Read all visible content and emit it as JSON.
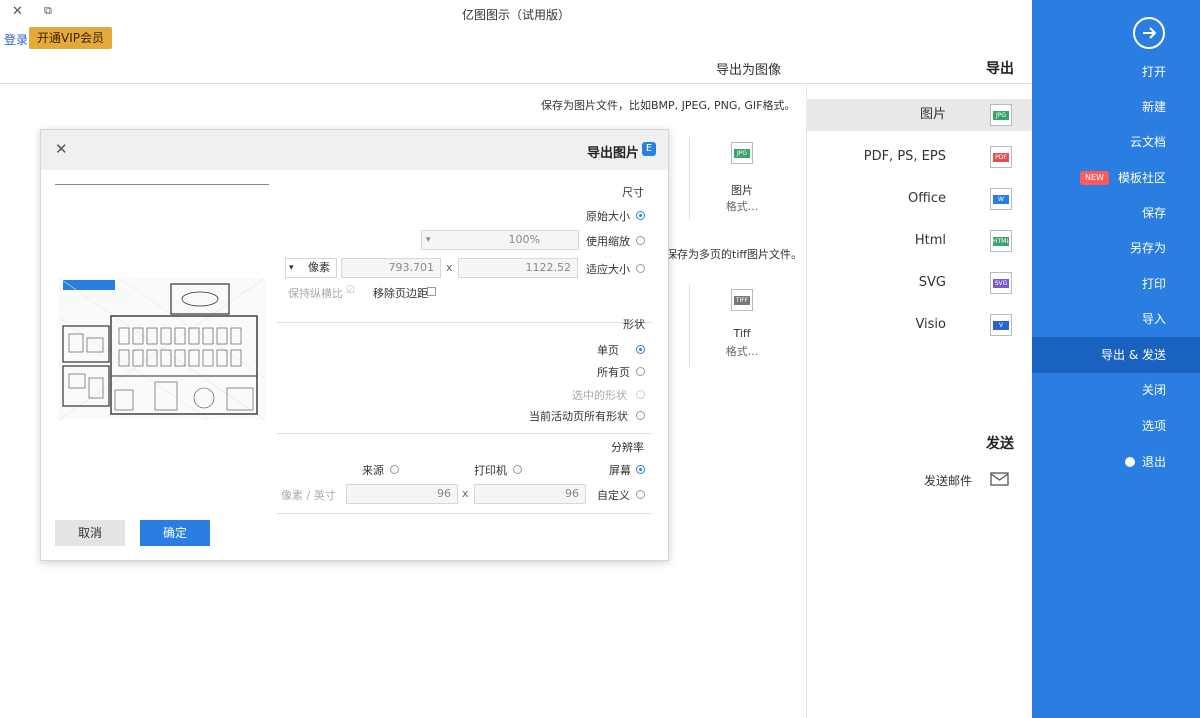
{
  "window": {
    "title": "亿图图示（试用版）",
    "controls": {
      "close": "✕",
      "restore": "⧉"
    },
    "login": "登录",
    "vip": "开通VIP会员"
  },
  "sidebar": {
    "items": [
      {
        "label": "打开"
      },
      {
        "label": "新建"
      },
      {
        "label": "云文档"
      },
      {
        "label": "模板社区",
        "badge": "NEW"
      },
      {
        "label": "保存"
      },
      {
        "label": "另存为"
      },
      {
        "label": "打印"
      },
      {
        "label": "导入"
      },
      {
        "label": "导出 & 发送"
      },
      {
        "label": "关闭"
      },
      {
        "label": "选项"
      },
      {
        "label": "退出"
      }
    ]
  },
  "export": {
    "heading": "导出",
    "formats": [
      {
        "label": "图片",
        "tag": "JPG",
        "color": "#3aa56a"
      },
      {
        "label": "PDF, PS, EPS",
        "tag": "PDF",
        "color": "#e0524a"
      },
      {
        "label": "Office",
        "tag": "W",
        "color": "#2a7de1"
      },
      {
        "label": "Html",
        "tag": "HTML",
        "color": "#3aa56a"
      },
      {
        "label": "SVG",
        "tag": "SVG",
        "color": "#7a5bd0"
      },
      {
        "label": "Visio",
        "tag": "V",
        "color": "#2a62d0"
      }
    ],
    "send_heading": "发送",
    "send_email": "发送邮件"
  },
  "panel": {
    "heading": "导出为图像",
    "desc1": "保存为图片文件，比如BMP, JPEG, PNG, GIF格式。",
    "desc2": "保存为多页的tiff图片文件。",
    "cards": [
      {
        "tag": "JPG",
        "label": "图片",
        "sub": "格式..."
      },
      {
        "tag": "TIFF",
        "label": "Tiff",
        "sub": "格式..."
      }
    ]
  },
  "dialog": {
    "title": "导出图片",
    "size_section": "尺寸",
    "size_opts": [
      "原始大小",
      "使用缩放",
      "适应大小"
    ],
    "scale_value": "100%",
    "width_value": "1122.52",
    "height_value": "793.701",
    "times": "x",
    "unit": "像素",
    "keep_ratio": "保持纵横比",
    "remove_margin": "移除页边距",
    "shape_section": "形状",
    "shape_opts": [
      "单页",
      "所有页",
      "选中的形状",
      "当前活动页所有形状"
    ],
    "res_section": "分辨率",
    "res_opts": [
      "屏幕",
      "打印机",
      "来源",
      "自定义"
    ],
    "dpi_x": "96",
    "dpi_y": "96",
    "dpi_unit": "像素 / 英寸",
    "ok": "确定",
    "cancel": "取消",
    "accent": "#2a7de1"
  }
}
